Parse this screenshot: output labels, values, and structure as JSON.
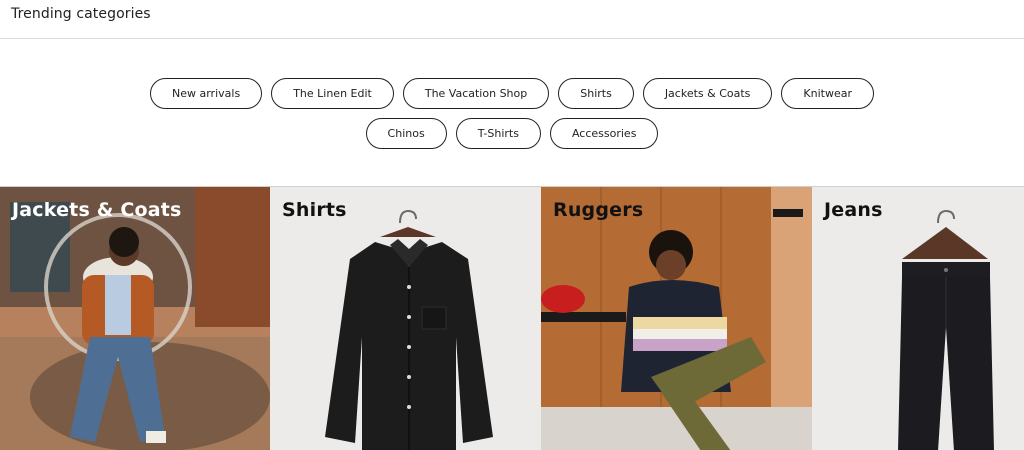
{
  "header": {
    "title": "Trending categories"
  },
  "pills": {
    "row1": [
      "New arrivals",
      "The Linen Edit",
      "The Vacation Shop",
      "Shirts",
      "Jackets & Coats",
      "Knitwear"
    ],
    "row2": [
      "Chinos",
      "T-Shirts",
      "Accessories"
    ]
  },
  "cards": [
    {
      "label": "Jackets & Coats",
      "image": "model-in-bubble-chair-photo",
      "label_color": "#ffffff"
    },
    {
      "label": "Shirts",
      "image": "black-shirt-on-hanger-photo",
      "label_color": "#111111"
    },
    {
      "label": "Ruggers",
      "image": "model-in-rugby-sweater-photo",
      "label_color": "#111111"
    },
    {
      "label": "Jeans",
      "image": "black-jeans-on-hanger-photo",
      "label_color": "#111111"
    }
  ]
}
